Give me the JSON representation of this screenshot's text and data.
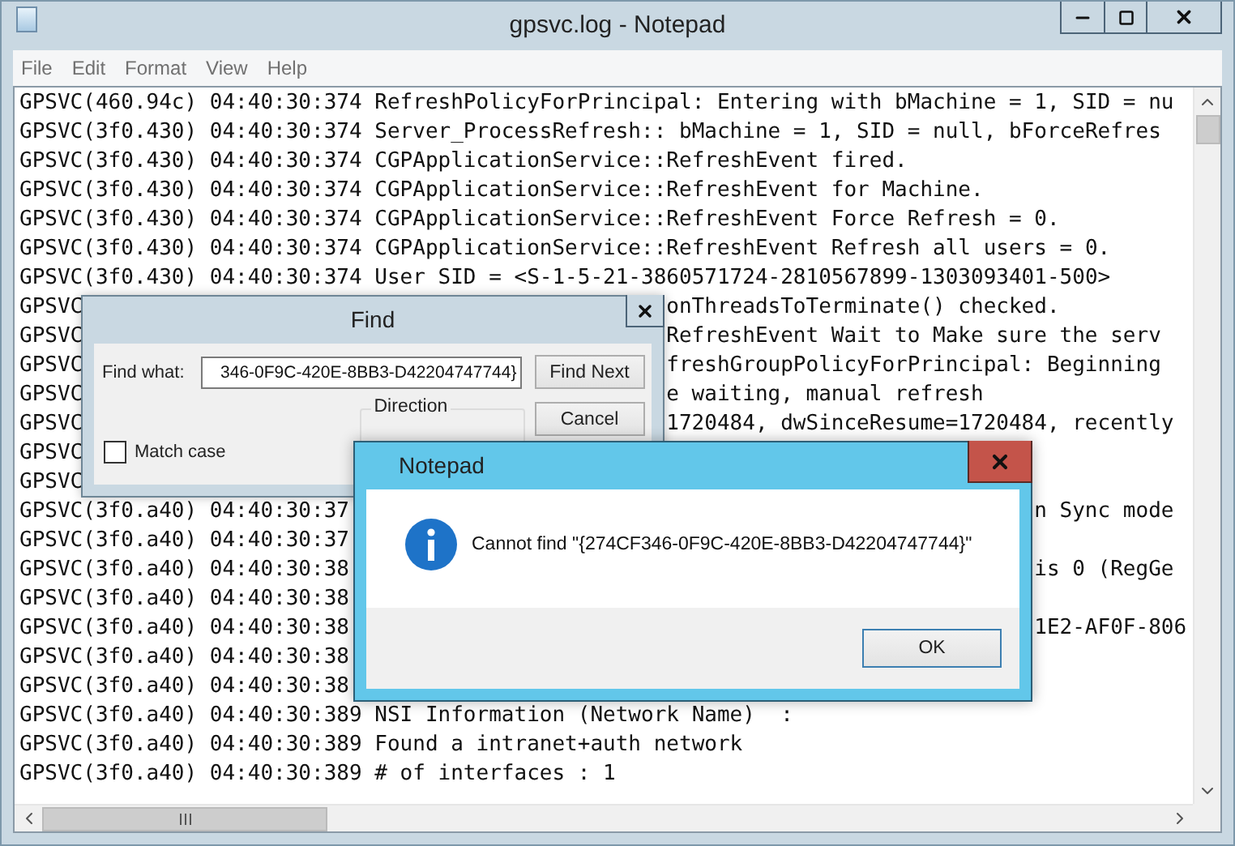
{
  "window": {
    "title": "gpsvc.log - Notepad"
  },
  "menu": [
    {
      "label": "File"
    },
    {
      "label": "Edit"
    },
    {
      "label": "Format"
    },
    {
      "label": "View"
    },
    {
      "label": "Help"
    }
  ],
  "editor": {
    "lines": [
      {
        "text": "GPSVC(460.94c) 04:40:30:374 RefreshPolicyForPrincipal: Entering with bMachine = 1, SID = nu"
      },
      {
        "text": "GPSVC(3f0.430) 04:40:30:374 Server_ProcessRefresh:: bMachine = 1, SID = null, bForceRefres"
      },
      {
        "text": "GPSVC(3f0.430) 04:40:30:374 CGPApplicationService::RefreshEvent fired."
      },
      {
        "text": "GPSVC(3f0.430) 04:40:30:374 CGPApplicationService::RefreshEvent for Machine."
      },
      {
        "text": "GPSVC(3f0.430) 04:40:30:374 CGPApplicationService::RefreshEvent Force Refresh = 0."
      },
      {
        "text": "GPSVC(3f0.430) 04:40:30:374 CGPApplicationService::RefreshEvent Refresh all users = 0."
      },
      {
        "text": "GPSVC(3f0.430) 04:40:30:374 User SID = <S-1-5-21-3860571724-2810567899-1303093401-500>"
      },
      {
        "text": "GPSVC",
        "kind": "split_find",
        "tail": "onThreadsToTerminate() checked."
      },
      {
        "text": "GPSVC",
        "kind": "split_find",
        "tail": "RefreshEvent Wait to Make sure the serv"
      },
      {
        "text": "GPSVC",
        "kind": "split_find",
        "tail": "freshGroupPolicyForPrincipal: Beginning"
      },
      {
        "text": "GPSVC",
        "kind": "split_find",
        "tail": "e waiting, manual refresh"
      },
      {
        "text": "GPSVC",
        "kind": "split_find",
        "tail": "1720484, dwSinceResume=1720484, recently"
      },
      {
        "text": "GPSVC"
      },
      {
        "text": "GPSVC"
      },
      {
        "text": "GPSVC(3f0.a40) 04:40:30:37",
        "kind": "split_message",
        "tail": "n Sync mode"
      },
      {
        "text": "GPSVC(3f0.a40) 04:40:30:37"
      },
      {
        "text": "GPSVC(3f0.a40) 04:40:30:38",
        "kind": "split_message",
        "tail": "is 0 (RegGe"
      },
      {
        "text": "GPSVC(3f0.a40) 04:40:30:38"
      },
      {
        "text": "GPSVC(3f0.a40) 04:40:30:38",
        "kind": "split_message",
        "tail": "1E2-AF0F-806"
      },
      {
        "text": "GPSVC(3f0.a40) 04:40:30:38"
      },
      {
        "text": "GPSVC(3f0.a40) 04:40:30:38"
      },
      {
        "text": "GPSVC(3f0.a40) 04:40:30:389 NSI Information (Network Name)  :"
      },
      {
        "text": "GPSVC(3f0.a40) 04:40:30:389 Found a intranet+auth network"
      },
      {
        "text": "GPSVC(3f0.a40) 04:40:30:389 # of interfaces : 1"
      }
    ]
  },
  "find_dialog": {
    "title": "Find",
    "find_what_label": "Find what:",
    "find_what_value": "346-0F9C-420E-8BB3-D42204747744}",
    "direction_label": "Direction",
    "match_case": {
      "label": "Match case",
      "checked": false
    },
    "buttons": [
      {
        "label": "Find Next"
      },
      {
        "label": "Cancel"
      }
    ]
  },
  "message_dialog": {
    "title": "Notepad",
    "message": "Cannot find \"{274CF346-0F9C-420E-8BB3-D42204747744}\"",
    "button": "OK"
  }
}
